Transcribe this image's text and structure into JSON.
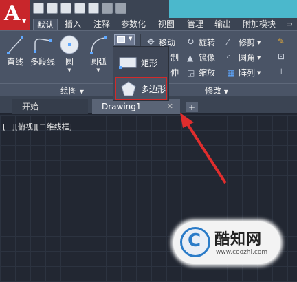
{
  "app": {
    "logo_letter": "A"
  },
  "ribbon_tabs": [
    "默认",
    "插入",
    "注释",
    "参数化",
    "视图",
    "管理",
    "输出",
    "附加模块"
  ],
  "draw_panel": {
    "title": "绘图",
    "tools": [
      {
        "label": "直线",
        "icon": "line-icon"
      },
      {
        "label": "多段线",
        "icon": "polyline-icon"
      },
      {
        "label": "圆",
        "icon": "circle-icon"
      },
      {
        "label": "圆弧",
        "icon": "arc-icon"
      }
    ]
  },
  "flyout": {
    "items": [
      {
        "label": "矩形",
        "icon": "rectangle-icon"
      },
      {
        "label": "多边形",
        "icon": "polygon-icon"
      }
    ]
  },
  "modify_panel": {
    "title": "修改",
    "rows": [
      [
        "移动",
        "旋转",
        "修剪"
      ],
      [
        "制",
        "镜像",
        "圆角"
      ],
      [
        "伸",
        "缩放",
        "阵列"
      ]
    ]
  },
  "file_tabs": {
    "start": "开始",
    "active": "Drawing1",
    "plus": "+"
  },
  "viewport_label": "[−][俯视][二维线框]",
  "watermark": {
    "brand": "酷知网",
    "url": "www.coozhi.com",
    "logo_letter": "C"
  },
  "colors": {
    "accent_red": "#d22a2a",
    "ribbon_bg": "#4a5466",
    "canvas_bg": "#222732"
  }
}
